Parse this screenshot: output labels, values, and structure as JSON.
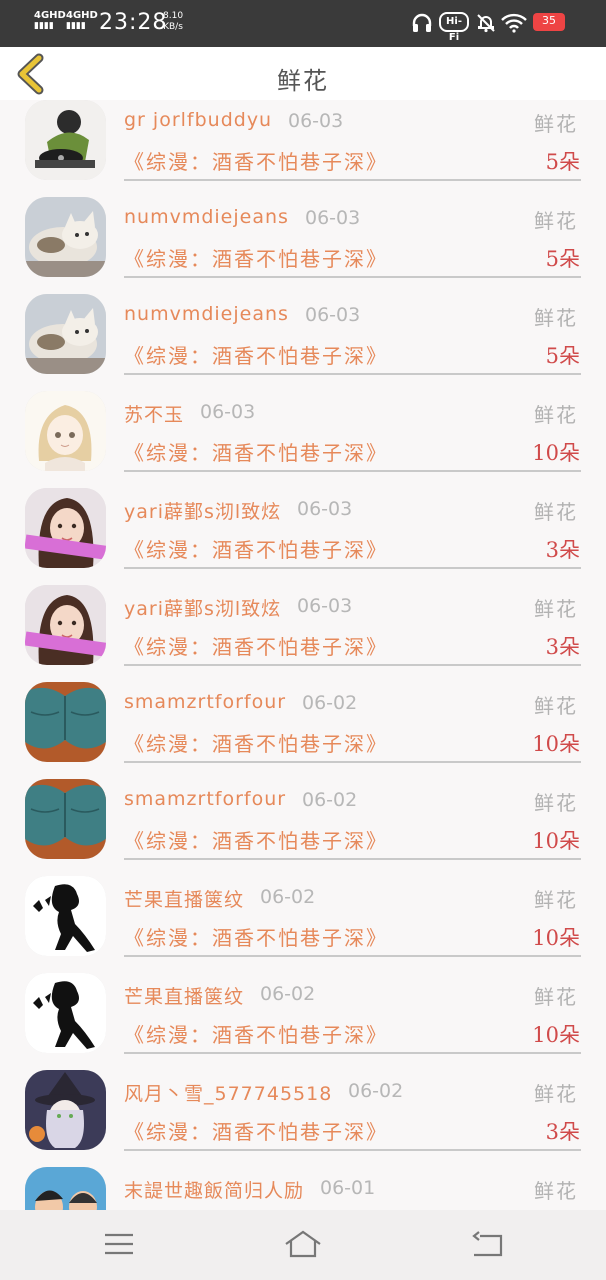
{
  "status": {
    "signal1": "4GHD",
    "signal2": "4GHD",
    "time": "23:28",
    "speed_value": "8.10",
    "speed_unit": "KB/s",
    "hifi": "Hi-Fi",
    "battery": "35"
  },
  "header": {
    "title": "鲜花"
  },
  "rows": [
    {
      "name": "gr jorlfbuddyu",
      "date": "06-03",
      "gift": "鲜花",
      "book": "《综漫：酒香不怕巷子深》",
      "count": "5朵",
      "avatar": "avatar-dj"
    },
    {
      "name": "numvmdiejeans",
      "date": "06-03",
      "gift": "鲜花",
      "book": "《综漫：酒香不怕巷子深》",
      "count": "5朵",
      "avatar": "avatar-cat"
    },
    {
      "name": "numvmdiejeans",
      "date": "06-03",
      "gift": "鲜花",
      "book": "《综漫：酒香不怕巷子深》",
      "count": "5朵",
      "avatar": "avatar-cat"
    },
    {
      "name": "苏不玉",
      "date": "06-03",
      "gift": "鲜花",
      "book": "《综漫：酒香不怕巷子深》",
      "count": "10朵",
      "avatar": "avatar-anime"
    },
    {
      "name": "yari薜鄞s沏l致炫",
      "date": "06-03",
      "gift": "鲜花",
      "book": "《综漫：酒香不怕巷子深》",
      "count": "3朵",
      "avatar": "avatar-girl"
    },
    {
      "name": "yari薜鄞s沏l致炫",
      "date": "06-03",
      "gift": "鲜花",
      "book": "《综漫：酒香不怕巷子深》",
      "count": "3朵",
      "avatar": "avatar-girl"
    },
    {
      "name": "smamzrtforfour",
      "date": "06-02",
      "gift": "鲜花",
      "book": "《综漫：酒香不怕巷子深》",
      "count": "10朵",
      "avatar": "avatar-jeans"
    },
    {
      "name": "smamzrtforfour",
      "date": "06-02",
      "gift": "鲜花",
      "book": "《综漫：酒香不怕巷子深》",
      "count": "10朵",
      "avatar": "avatar-jeans"
    },
    {
      "name": "芒果直播箧纹",
      "date": "06-02",
      "gift": "鲜花",
      "book": "《综漫：酒香不怕巷子深》",
      "count": "10朵",
      "avatar": "avatar-silhouette"
    },
    {
      "name": "芒果直播箧纹",
      "date": "06-02",
      "gift": "鲜花",
      "book": "《综漫：酒香不怕巷子深》",
      "count": "10朵",
      "avatar": "avatar-silhouette"
    },
    {
      "name": "风月丶雪_577745518",
      "date": "06-02",
      "gift": "鲜花",
      "book": "《综漫：酒香不怕巷子深》",
      "count": "3朵",
      "avatar": "avatar-witch"
    },
    {
      "name": "末諟世趣飯简归人励",
      "date": "06-01",
      "gift": "鲜花",
      "book": "",
      "count": "",
      "avatar": "avatar-couple"
    }
  ],
  "colors": {
    "name": "#e6895a",
    "book": "#e6895a",
    "count": "#d04a4a",
    "date": "#b7b7b7",
    "back_arrow": "#e8c436"
  },
  "nav": {
    "menu_icon": "menu-icon",
    "home_icon": "home-icon",
    "back_icon": "return-icon"
  }
}
